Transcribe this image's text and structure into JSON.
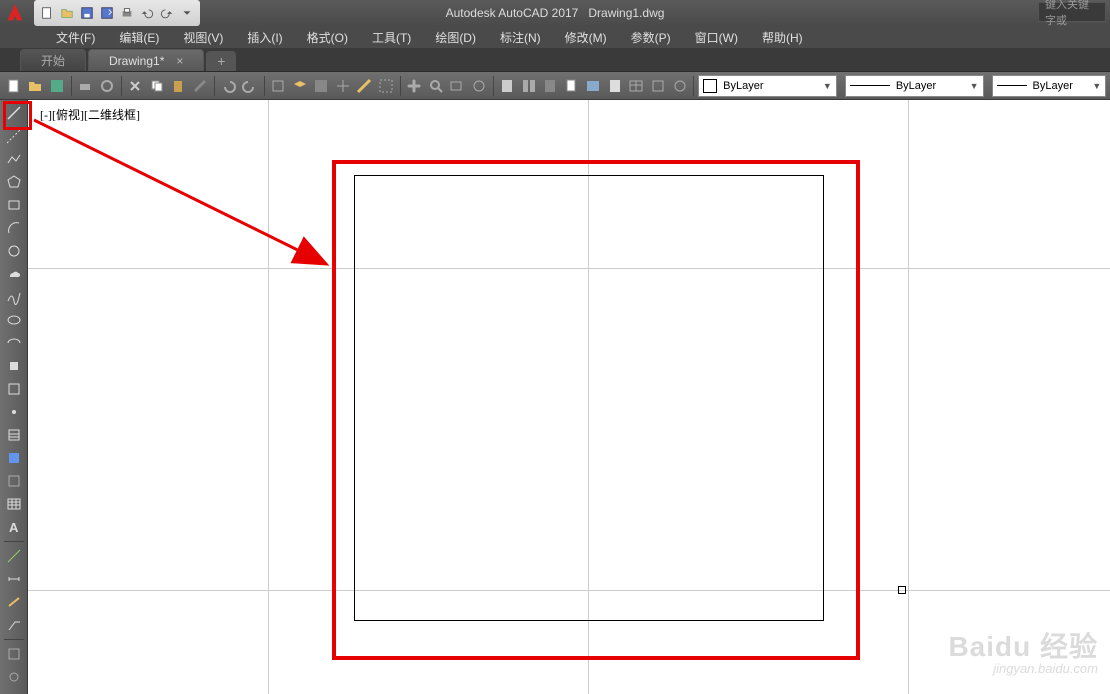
{
  "titlebar": {
    "app_name": "Autodesk AutoCAD 2017",
    "doc_name": "Drawing1.dwg",
    "search_placeholder": "键入关键字或"
  },
  "menubar": {
    "items": [
      {
        "label": "文件(F)"
      },
      {
        "label": "编辑(E)"
      },
      {
        "label": "视图(V)"
      },
      {
        "label": "插入(I)"
      },
      {
        "label": "格式(O)"
      },
      {
        "label": "工具(T)"
      },
      {
        "label": "绘图(D)"
      },
      {
        "label": "标注(N)"
      },
      {
        "label": "修改(M)"
      },
      {
        "label": "参数(P)"
      },
      {
        "label": "窗口(W)"
      },
      {
        "label": "帮助(H)"
      }
    ]
  },
  "filetabs": {
    "tabs": [
      {
        "label": "开始"
      },
      {
        "label": "Drawing1*"
      }
    ],
    "add": "+"
  },
  "properties": {
    "layer": "ByLayer",
    "linetype": "ByLayer",
    "lineweight": "ByLayer"
  },
  "viewport": {
    "label": "[-][俯视][二维线框]"
  },
  "watermark": {
    "main": "Baidu 经验",
    "sub": "jingyan.baidu.com"
  }
}
